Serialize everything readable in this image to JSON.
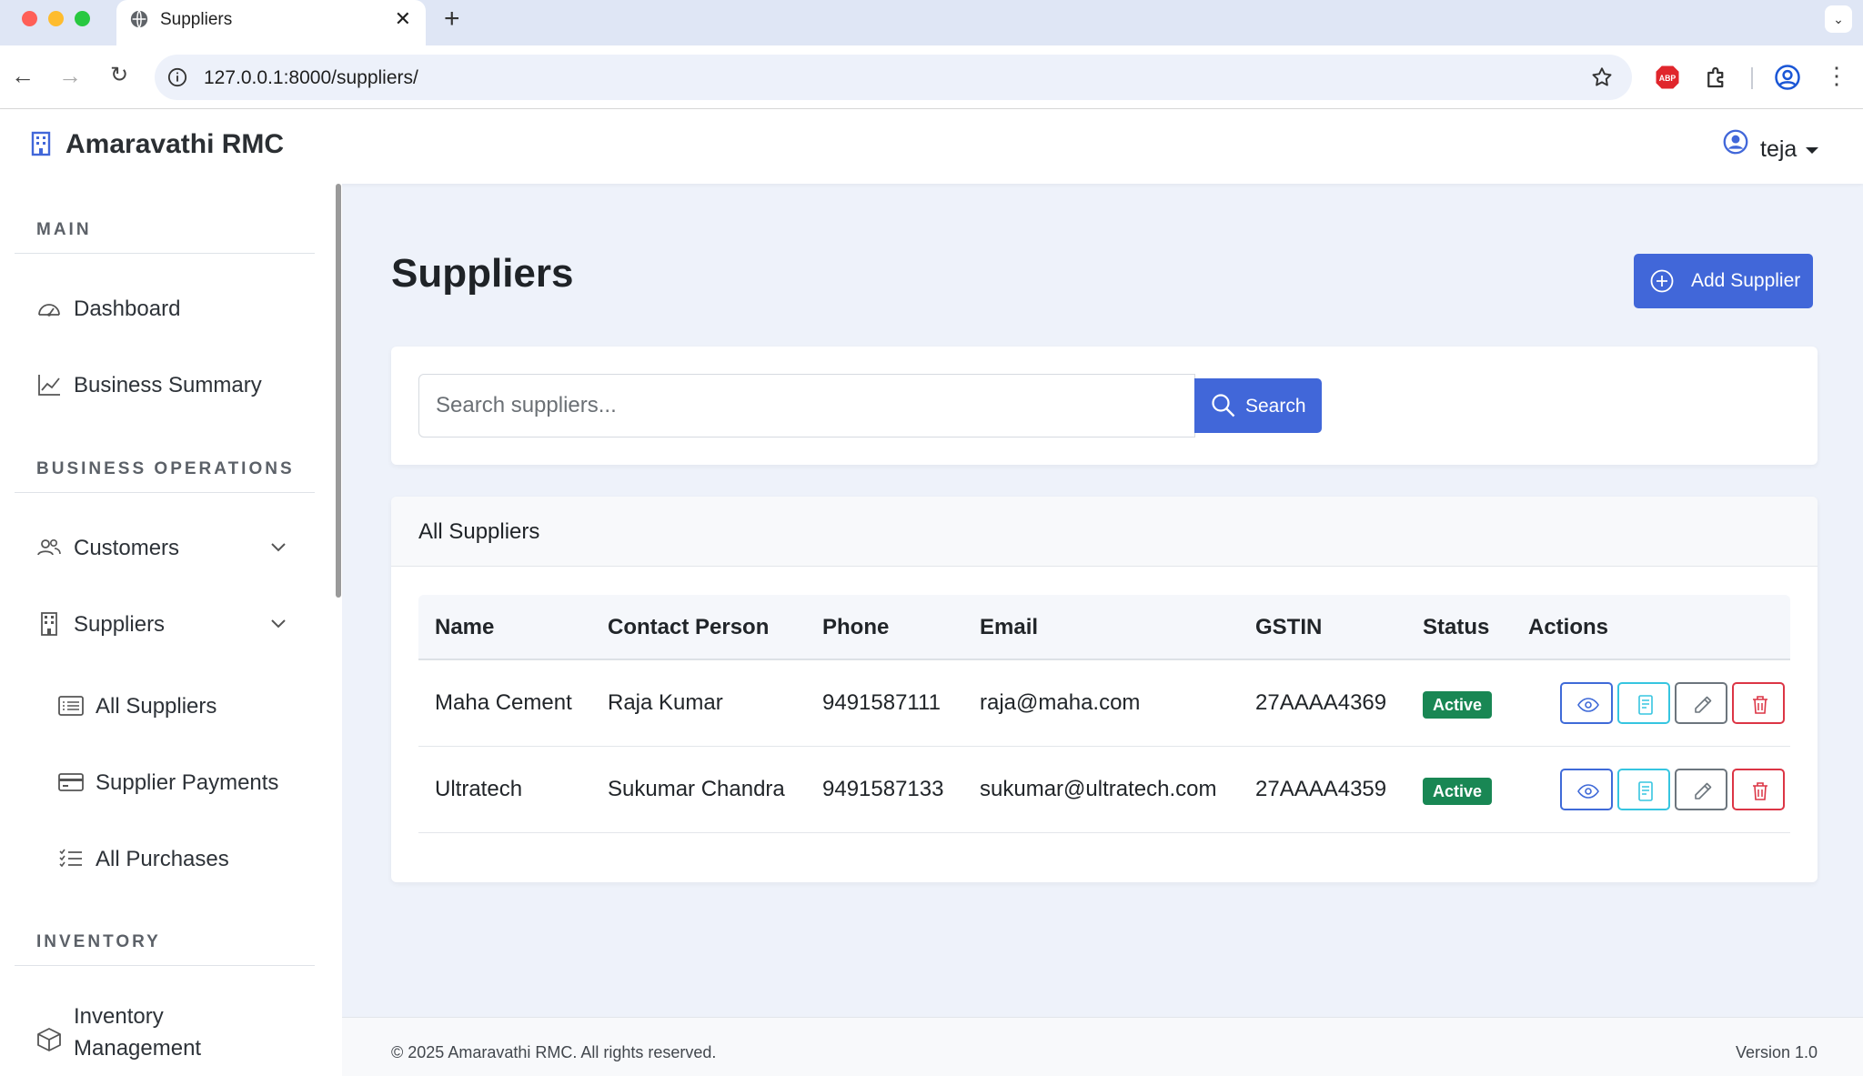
{
  "browser": {
    "tab_title": "Suppliers",
    "url": "127.0.0.1:8000/suppliers/"
  },
  "header": {
    "brand": "Amaravathi RMC",
    "user": "teja"
  },
  "sidebar": {
    "sections": {
      "main": "MAIN",
      "business": "BUSINESS OPERATIONS",
      "inventory": "INVENTORY"
    },
    "items": {
      "dashboard": "Dashboard",
      "business_summary": "Business Summary",
      "customers": "Customers",
      "suppliers": "Suppliers",
      "all_suppliers": "All Suppliers",
      "supplier_payments": "Supplier Payments",
      "all_purchases": "All Purchases",
      "inventory_management_1": "Inventory",
      "inventory_management_2": "Management"
    }
  },
  "main": {
    "page_title": "Suppliers",
    "add_button": "Add Supplier",
    "search_placeholder": "Search suppliers...",
    "search_button": "Search",
    "table_title": "All Suppliers",
    "columns": [
      "Name",
      "Contact Person",
      "Phone",
      "Email",
      "GSTIN",
      "Status",
      "Actions"
    ],
    "rows": [
      {
        "name": "Maha Cement",
        "contact": "Raja Kumar",
        "phone": "9491587111",
        "email": "raja@maha.com",
        "gstin": "27AAAA4369",
        "status": "Active"
      },
      {
        "name": "Ultratech",
        "contact": "Sukumar Chandra",
        "phone": "9491587133",
        "email": "sukumar@ultratech.com",
        "gstin": "27AAAA4359",
        "status": "Active"
      }
    ]
  },
  "footer": {
    "copyright": "© 2025 Amaravathi RMC. All rights reserved.",
    "version": "Version 1.0"
  },
  "colors": {
    "primary": "#4167d9",
    "success": "#198754",
    "danger": "#dc3545",
    "info": "#36c5e0"
  }
}
